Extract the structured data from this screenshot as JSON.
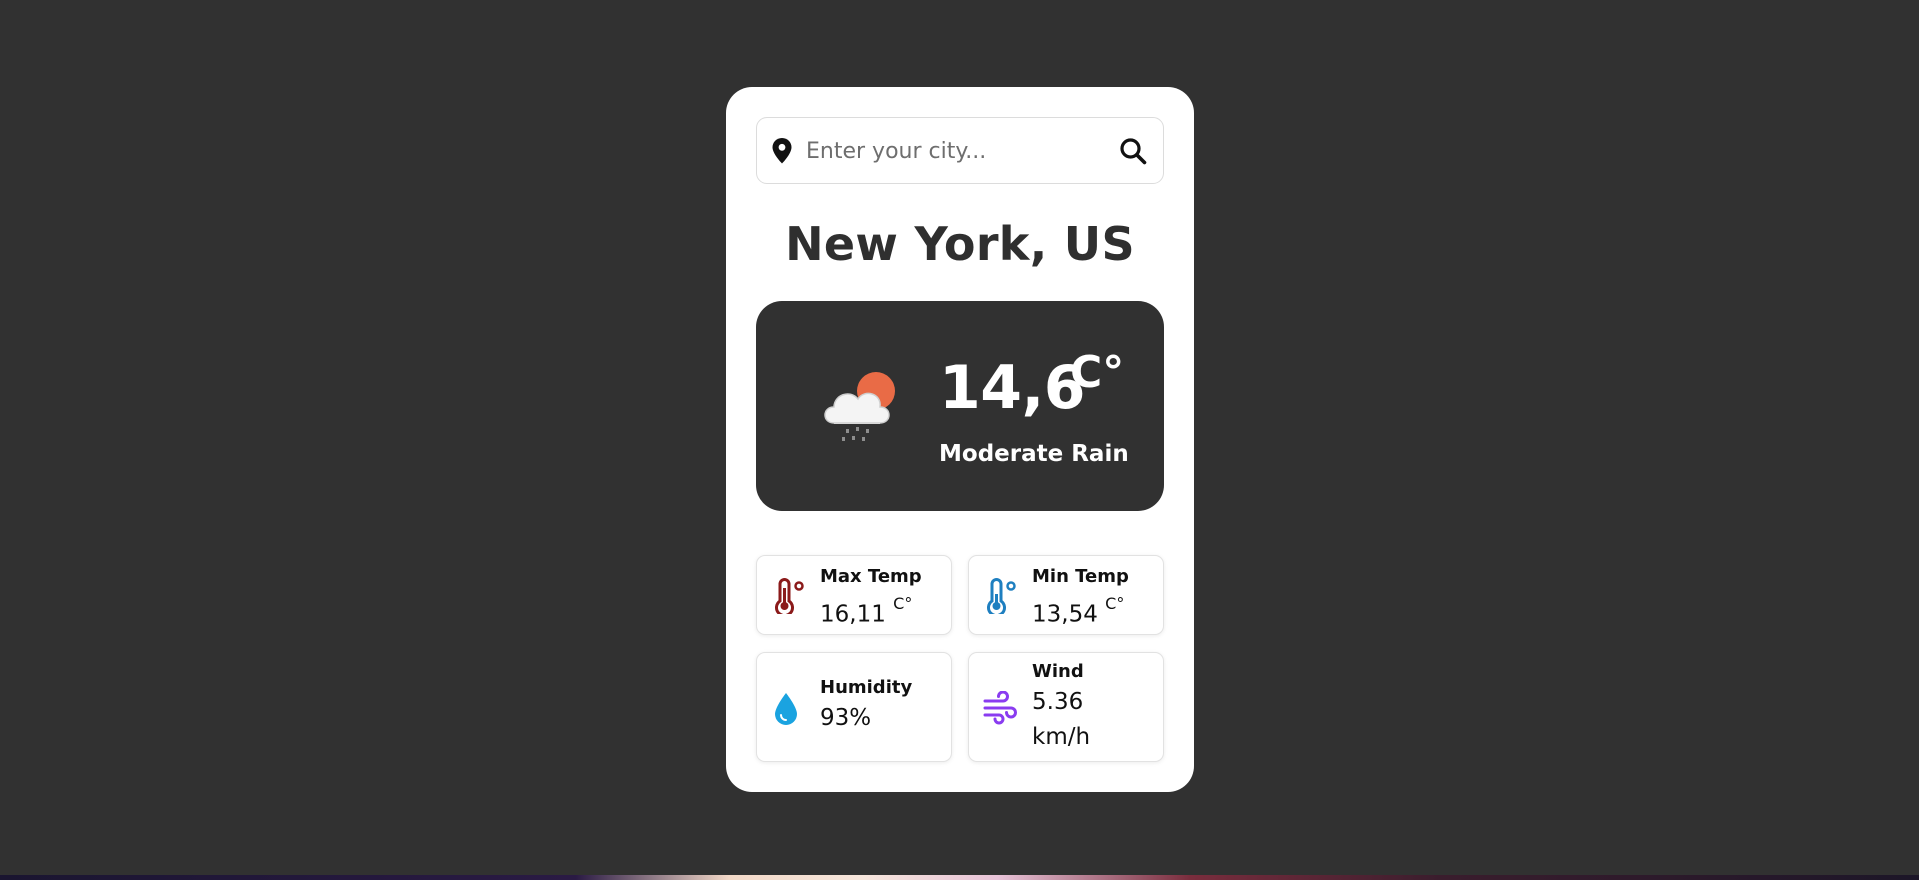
{
  "search": {
    "placeholder": "Enter your city...",
    "value": ""
  },
  "location": {
    "city": "New York, US"
  },
  "current": {
    "temperature": "14,6",
    "unit": "C°",
    "description": "Moderate Rain",
    "icon": "cloud-sun-rain-icon"
  },
  "stats": {
    "max_temp": {
      "label": "Max Temp",
      "value": "16,11",
      "unit": "C°",
      "icon": "thermometer-hot-icon",
      "color": "#8b1a1a"
    },
    "min_temp": {
      "label": "Min Temp",
      "value": "13,54",
      "unit": "C°",
      "icon": "thermometer-cold-icon",
      "color": "#1e7fc0"
    },
    "humidity": {
      "label": "Humidity",
      "value": "93%",
      "icon": "water-drop-icon",
      "color": "#1aa3e0"
    },
    "wind": {
      "label": "Wind",
      "value_line1": "5.36",
      "value_line2": "km/h",
      "icon": "wind-icon",
      "color": "#8a3cf0"
    }
  },
  "colors": {
    "background": "#313131",
    "card": "#ffffff",
    "main_panel": "#313131"
  }
}
